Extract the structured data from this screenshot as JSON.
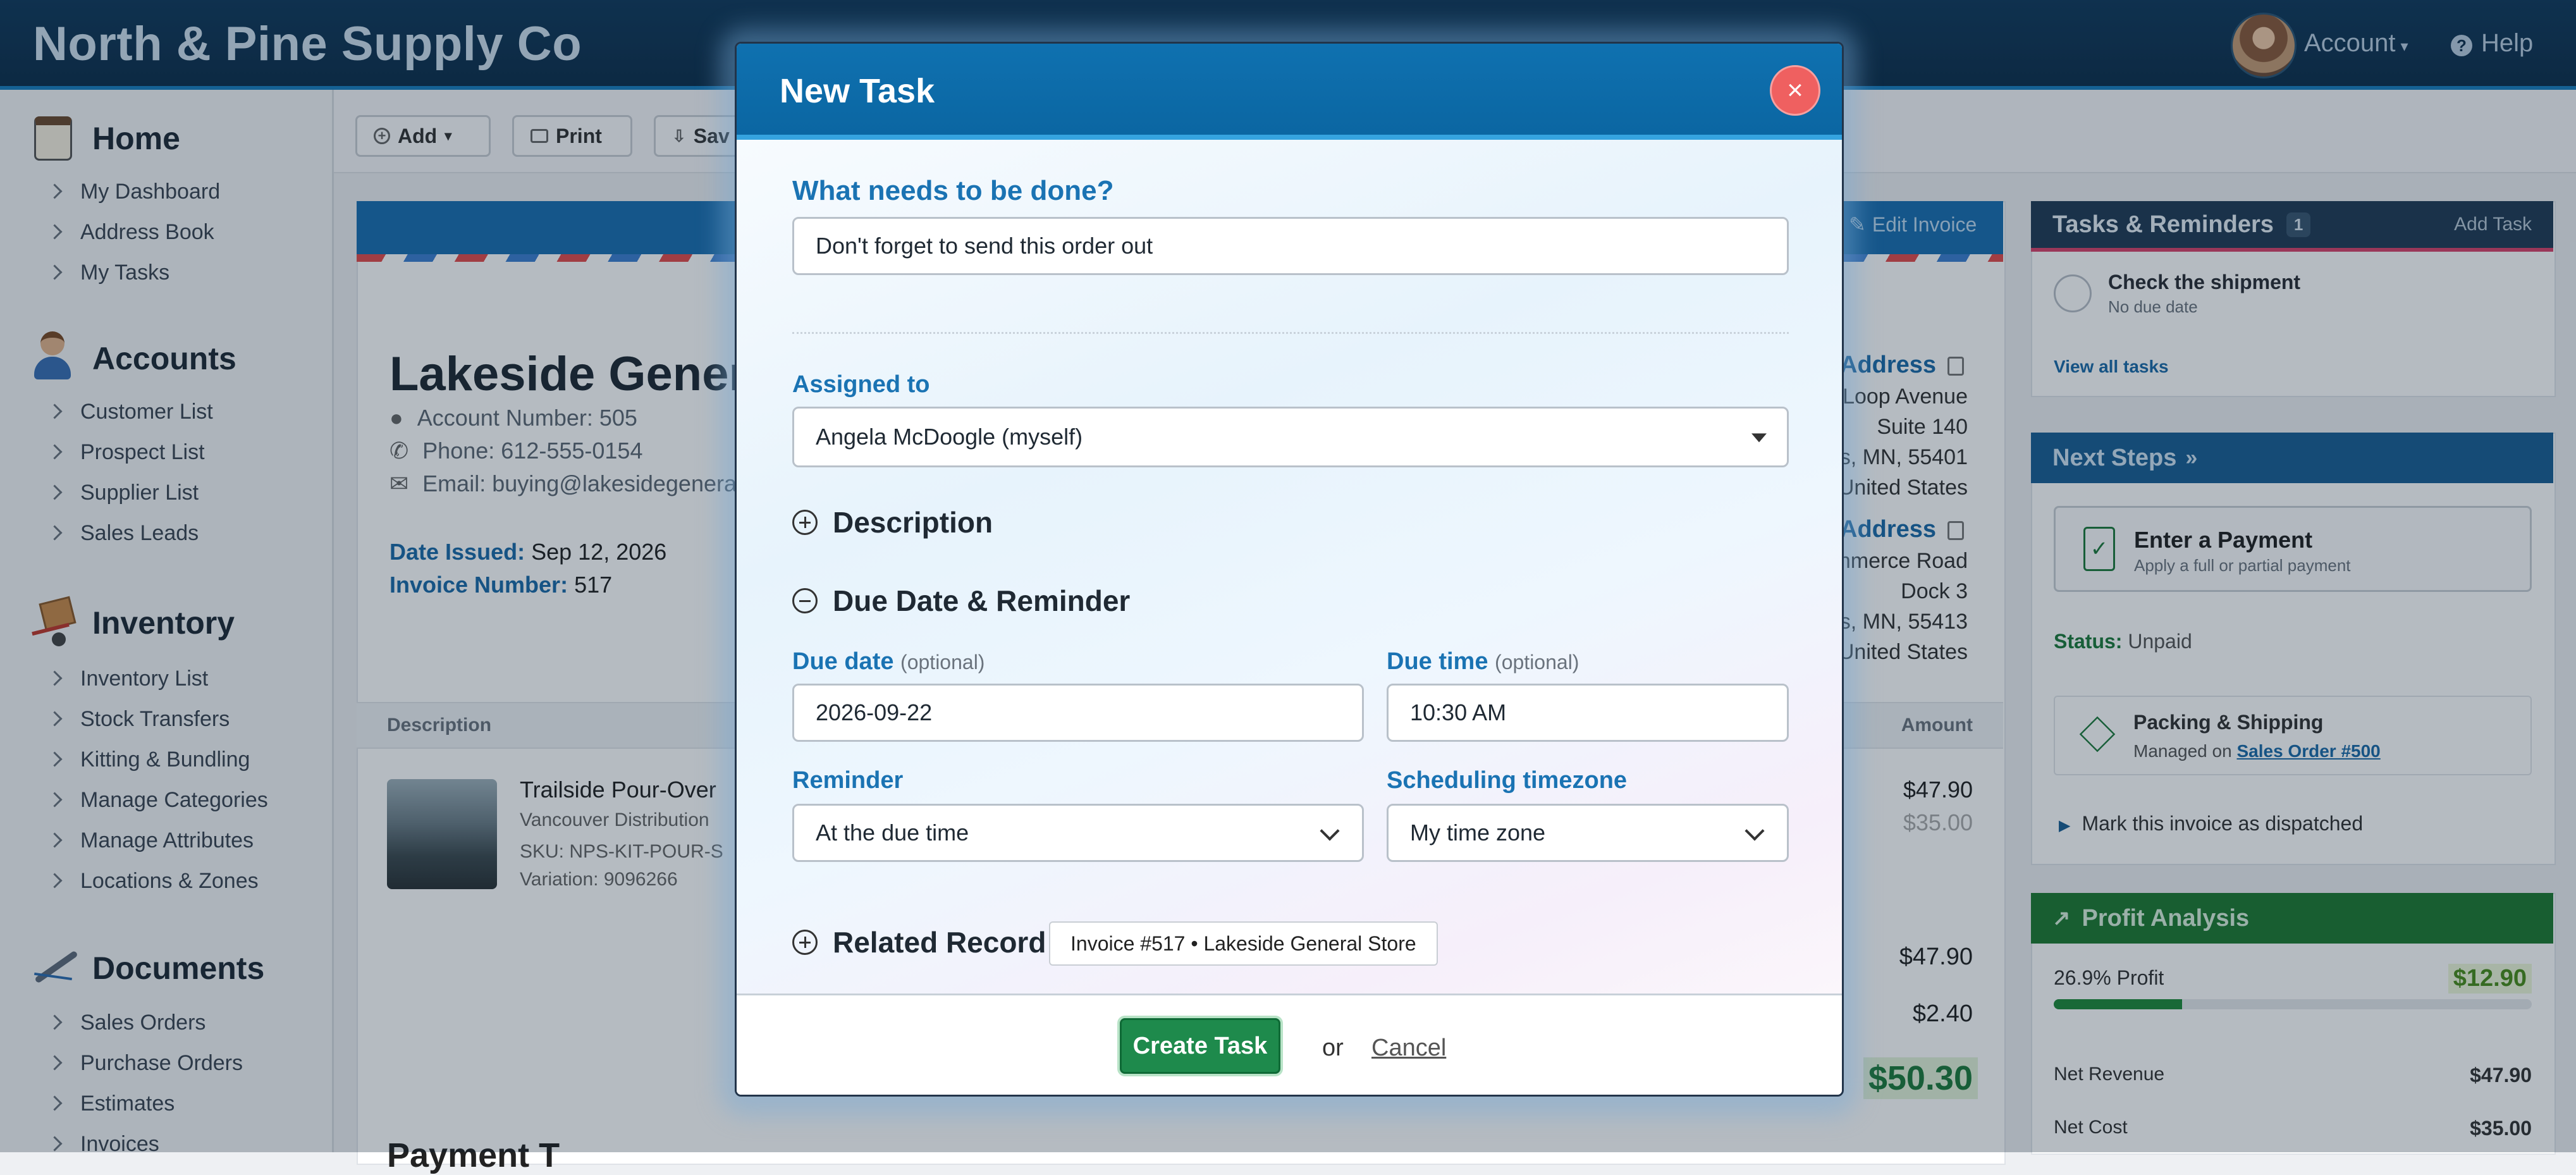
{
  "app": {
    "brand": "North & Pine Supply Co",
    "account": "Account",
    "help": "Help"
  },
  "sidebar": {
    "sections": [
      {
        "title": "Home",
        "items": [
          "My Dashboard",
          "Address Book",
          "My Tasks"
        ]
      },
      {
        "title": "Accounts",
        "items": [
          "Customer List",
          "Prospect List",
          "Supplier List",
          "Sales Leads"
        ]
      },
      {
        "title": "Inventory",
        "items": [
          "Inventory List",
          "Stock Transfers",
          "Kitting & Bundling",
          "Manage Categories",
          "Manage Attributes",
          "Locations & Zones"
        ]
      },
      {
        "title": "Documents",
        "items": [
          "Sales Orders",
          "Purchase Orders",
          "Estimates",
          "Invoices"
        ]
      }
    ]
  },
  "toolbar": {
    "add": "Add",
    "print": "Print",
    "save": "Sav"
  },
  "invoice": {
    "edit": "Edit Invoice",
    "customer": "Lakeside Genera",
    "account_number": "Account Number: 505",
    "phone": "Phone: 612-555-0154",
    "email": "Email: buying@lakesidegenera",
    "date_label": "Date Issued:",
    "date_value": "Sep 12, 2026",
    "number_label": "Invoice Number:",
    "number_value": "517",
    "billing_head": "Address",
    "billing": [
      "Loop Avenue",
      "Suite 140",
      "s, MN, 55401",
      "United States"
    ],
    "shipping_head": "Address",
    "shipping": [
      "nmerce Road",
      "Dock 3",
      "s, MN, 55413",
      "United States"
    ],
    "col_description": "Description",
    "col_amount": "Amount",
    "item_name": "Trailside Pour-Over",
    "item_vendor": "Vancouver Distribution",
    "item_sku": "SKU: NPS-KIT-POUR-S",
    "item_variation": "Variation: 9096266",
    "item_price": "$47.90",
    "item_cost": "$35.00",
    "subtotal": "$47.90",
    "tax": "$2.40",
    "total": "$50.30",
    "footer_partial": "Payment T"
  },
  "tasks_panel": {
    "title": "Tasks & Reminders",
    "count": "1",
    "add": "Add Task",
    "task_title": "Check the shipment",
    "task_due": "No due date",
    "view_all": "View all tasks"
  },
  "next_steps": {
    "title": "Next Steps",
    "payment_title": "Enter a Payment",
    "payment_sub": "Apply a full or partial payment",
    "status_label": "Status:",
    "status_value": "Unpaid",
    "ship_title": "Packing & Shipping",
    "ship_sub_prefix": "Managed on",
    "ship_link": "Sales Order #500",
    "dispatch": "Mark this invoice as dispatched"
  },
  "profit": {
    "title": "Profit Analysis",
    "percent_label": "26.9% Profit",
    "profit_value": "$12.90",
    "profit_fraction": 0.269,
    "net_revenue_label": "Net Revenue",
    "net_revenue": "$47.90",
    "net_cost_label": "Net Cost",
    "net_cost": "$35.00"
  },
  "modal": {
    "title": "New Task",
    "what_label": "What needs to be done?",
    "what_value": "Don't forget to send this order out",
    "assigned_label": "Assigned to",
    "assigned_value": "Angela McDoogle (myself)",
    "description_toggle": "Description",
    "due_toggle": "Due Date & Reminder",
    "due_date_label": "Due date",
    "optional": "(optional)",
    "due_date_value": "2026-09-22",
    "due_time_label": "Due time",
    "due_time_value": "10:30 AM",
    "reminder_label": "Reminder",
    "reminder_value": "At the due time",
    "tz_label": "Scheduling timezone",
    "tz_value": "My time zone",
    "related_toggle": "Related Record",
    "related_chip": "Invoice #517 • Lakeside General Store",
    "create": "Create Task",
    "or": "or",
    "cancel": "Cancel"
  }
}
